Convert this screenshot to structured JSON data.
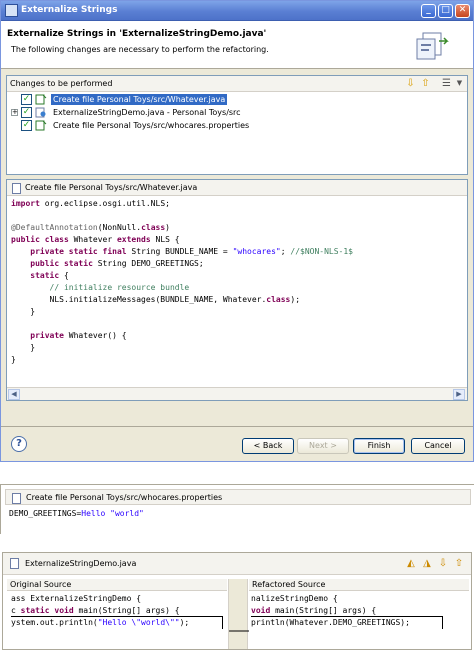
{
  "window": {
    "title": "Externalize Strings",
    "controls": {
      "minimize": "_",
      "maximize": "□",
      "close": "✕"
    }
  },
  "header": {
    "title": "Externalize Strings in 'ExternalizeStringDemo.java'",
    "subtitle": "The following changes are necessary to perform the refactoring."
  },
  "changes": {
    "label": "Changes to be performed",
    "items": [
      {
        "label": "Create file Personal Toys/src/Whatever.java",
        "selected": true,
        "expandable": false
      },
      {
        "label": "ExternalizeStringDemo.java - Personal Toys/src",
        "selected": false,
        "expandable": true
      },
      {
        "label": "Create file Personal Toys/src/whocares.properties",
        "selected": false,
        "expandable": false
      }
    ]
  },
  "preview": {
    "label": "Create file Personal Toys/src/Whatever.java",
    "code": [
      [
        {
          "t": "import",
          "c": "kw"
        },
        {
          "t": " org.eclipse.osgi.util.NLS;"
        }
      ],
      [],
      [
        {
          "t": "@DefaultAnnotation",
          "c": "ann"
        },
        {
          "t": "(NonNull."
        },
        {
          "t": "class",
          "c": "kw"
        },
        {
          "t": ")"
        }
      ],
      [
        {
          "t": "public class",
          "c": "kw"
        },
        {
          "t": " Whatever "
        },
        {
          "t": "extends",
          "c": "kw"
        },
        {
          "t": " NLS {"
        }
      ],
      [
        {
          "t": "    "
        },
        {
          "t": "private static final",
          "c": "kw"
        },
        {
          "t": " String BUNDLE_NAME = "
        },
        {
          "t": "\"whocares\"",
          "c": "str"
        },
        {
          "t": "; "
        },
        {
          "t": "//$NON-NLS-1$",
          "c": "cmt"
        }
      ],
      [
        {
          "t": "    "
        },
        {
          "t": "public static",
          "c": "kw"
        },
        {
          "t": " String DEMO_GREETINGS;"
        }
      ],
      [
        {
          "t": "    "
        },
        {
          "t": "static",
          "c": "kw"
        },
        {
          "t": " {"
        }
      ],
      [
        {
          "t": "        "
        },
        {
          "t": "// initialize resource bundle",
          "c": "cmt"
        }
      ],
      [
        {
          "t": "        NLS.initializeMessages(BUNDLE_NAME, Whatever."
        },
        {
          "t": "class",
          "c": "kw"
        },
        {
          "t": ");"
        }
      ],
      [
        {
          "t": "    }"
        }
      ],
      [],
      [
        {
          "t": "    "
        },
        {
          "t": "private",
          "c": "kw"
        },
        {
          "t": " Whatever() {"
        }
      ],
      [
        {
          "t": "    }"
        }
      ],
      [
        {
          "t": "}"
        }
      ]
    ]
  },
  "buttons": {
    "help": "?",
    "back": "< Back",
    "next": "Next >",
    "finish": "Finish",
    "cancel": "Cancel"
  },
  "properties_preview": {
    "label": "Create file Personal Toys/src/whocares.properties",
    "code": "DEMO_GREETINGS=Hello \"world\""
  },
  "compare": {
    "label": "ExternalizeStringDemo.java",
    "original_label": "Original Source",
    "refactored_label": "Refactored Source",
    "original_lines": [
      "ass ExternalizeStringDemo {",
      "c static void main(String[] args) {",
      "ystem.out.println(\"Hello \\\"world\\\"\");"
    ],
    "refactored_lines": [
      "nalizeStringDemo {",
      "void main(String[] args) {",
      "println(Whatever.DEMO_GREETINGS);"
    ]
  }
}
